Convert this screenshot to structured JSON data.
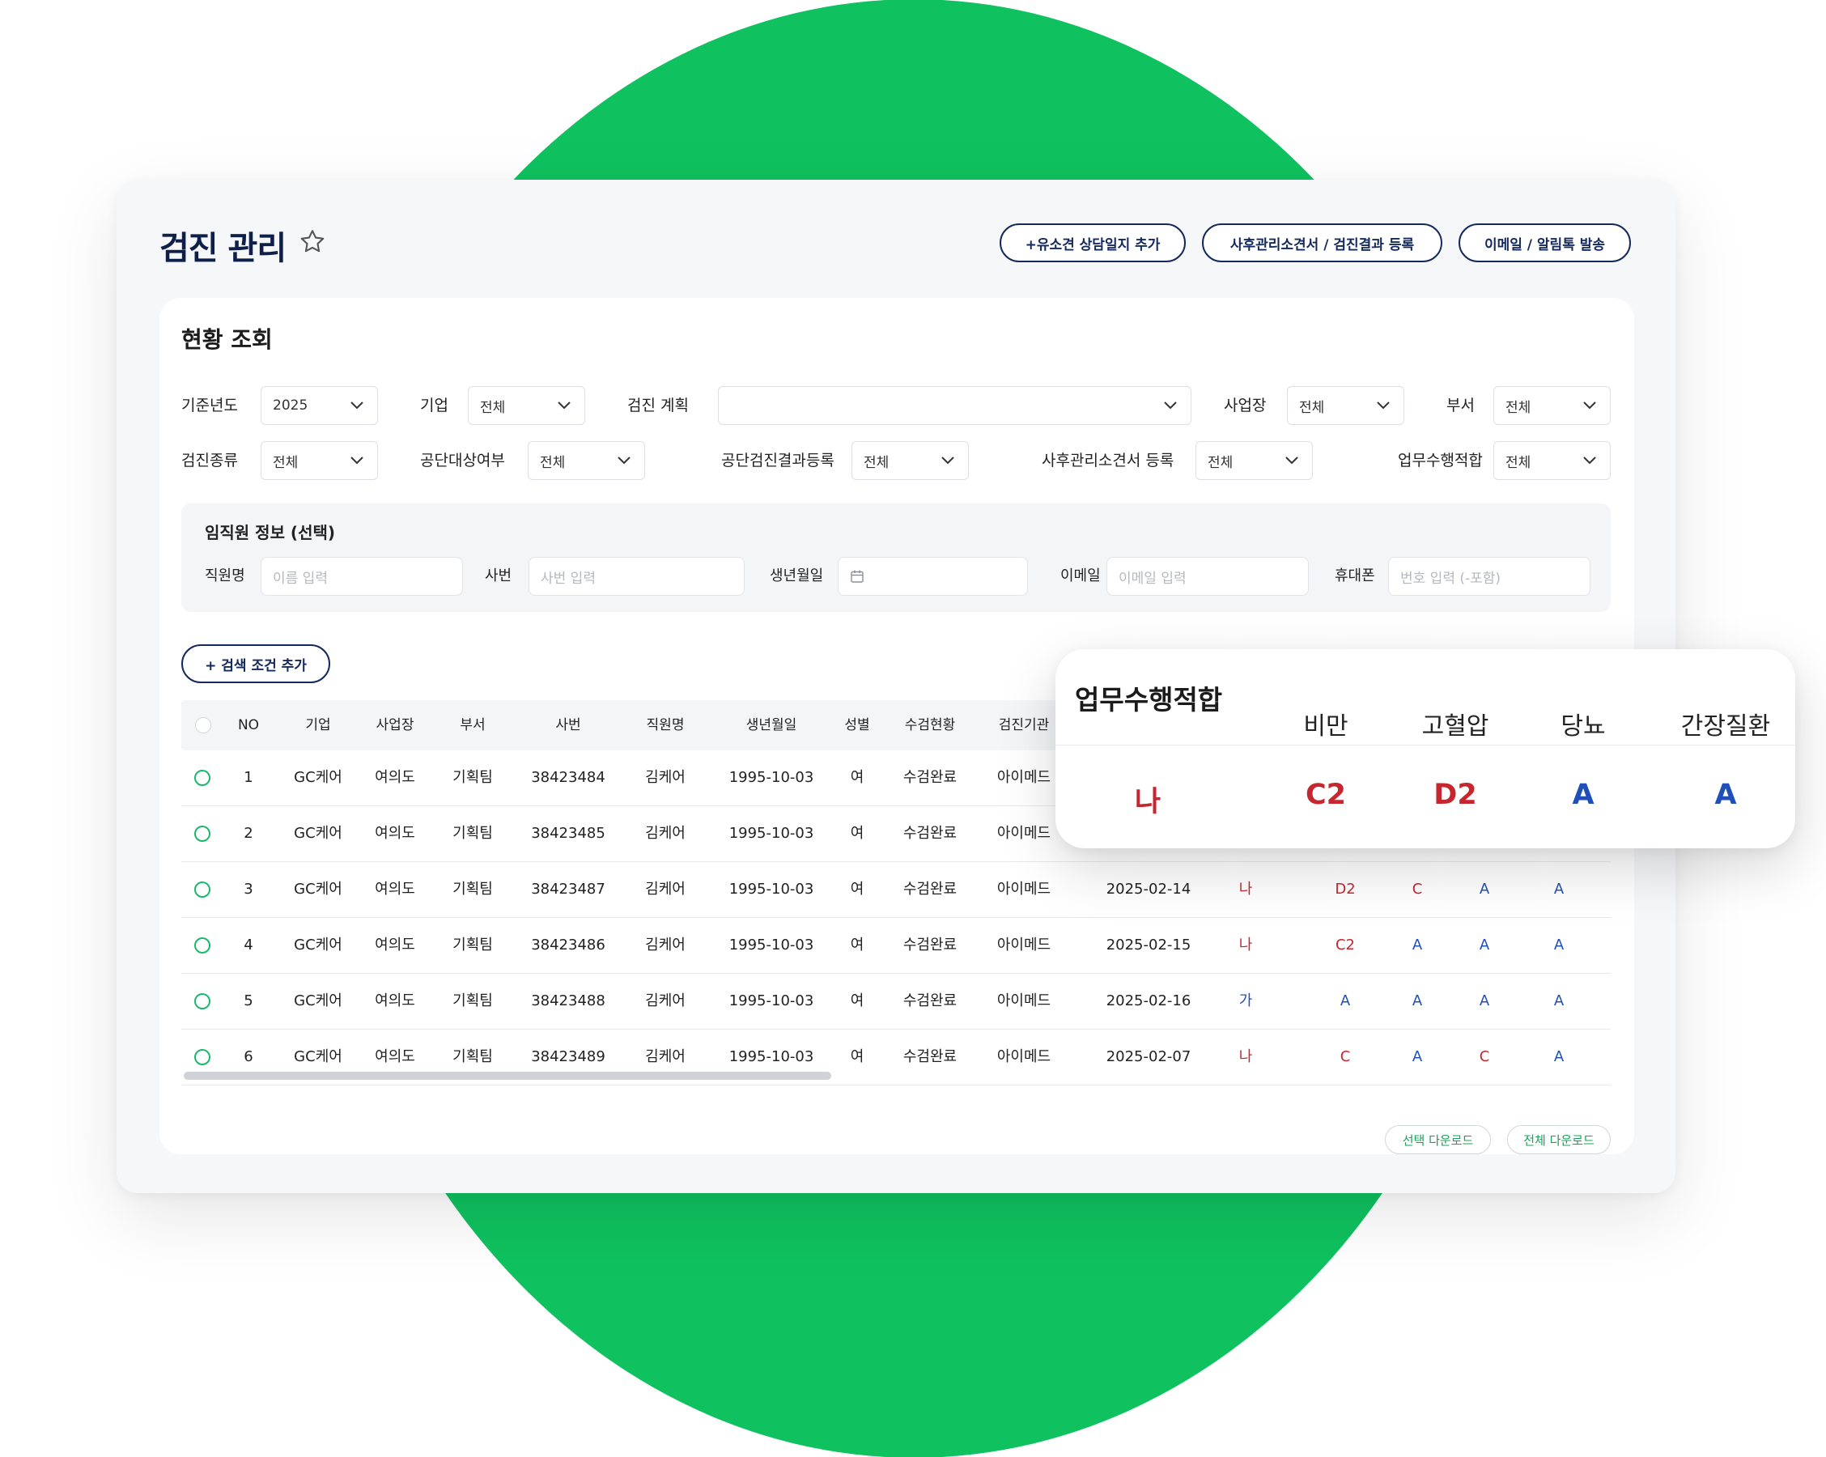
{
  "header": {
    "title": "검진 관리",
    "buttons": {
      "add_log": "+유소견 상담일지 추가",
      "register": "사후관리소견서 / 검진결과 등록",
      "send": "이메일 / 알림톡 발송"
    }
  },
  "status_card": {
    "title": "현황 조회",
    "filters": {
      "year": {
        "label": "기준년도",
        "value": "2025"
      },
      "company": {
        "label": "기업",
        "value": "전체"
      },
      "plan": {
        "label": "검진 계획",
        "value": ""
      },
      "site": {
        "label": "사업장",
        "value": "전체"
      },
      "dept": {
        "label": "부서",
        "value": "전체"
      },
      "checkup_type": {
        "label": "검진종류",
        "value": "전체"
      },
      "nhis_target": {
        "label": "공단대상여부",
        "value": "전체"
      },
      "nhis_result": {
        "label": "공단검진결과등록",
        "value": "전체"
      },
      "followup_reg": {
        "label": "사후관리소견서 등록",
        "value": "전체"
      },
      "fitness": {
        "label": "업무수행적합",
        "value": "전체"
      }
    },
    "employee": {
      "title": "임직원 정보 (선택)",
      "name": {
        "label": "직원명",
        "placeholder": "이름 입력"
      },
      "emp_no": {
        "label": "사번",
        "placeholder": "사번 입력"
      },
      "birth": {
        "label": "생년월일",
        "placeholder": ""
      },
      "email": {
        "label": "이메일",
        "placeholder": "이메일 입력"
      },
      "phone": {
        "label": "휴대폰",
        "placeholder": "번호 입력 (-포함)"
      }
    },
    "add_condition": "+ 검색 조건 추가",
    "download_selected": "선택 다운로드",
    "download_all": "전체 다운로드"
  },
  "table": {
    "headers": [
      "NO",
      "기업",
      "사업장",
      "부서",
      "사번",
      "직원명",
      "생년월일",
      "성별",
      "수검현황",
      "검진기관"
    ],
    "rows": [
      {
        "no": "1",
        "company": "GC케어",
        "site": "여의도",
        "dept": "기획팀",
        "emp_no": "38423484",
        "name": "김케어",
        "birth": "1995-10-03",
        "gender": "여",
        "status": "수검완료",
        "org": "아이메드",
        "date": "",
        "fitness": "",
        "obesity": "",
        "bp": "",
        "diabetes": "",
        "liver": ""
      },
      {
        "no": "2",
        "company": "GC케어",
        "site": "여의도",
        "dept": "기획팀",
        "emp_no": "38423485",
        "name": "김케어",
        "birth": "1995-10-03",
        "gender": "여",
        "status": "수검완료",
        "org": "아이메드",
        "date": "",
        "fitness": "",
        "obesity": "",
        "bp": "",
        "diabetes": "",
        "liver": ""
      },
      {
        "no": "3",
        "company": "GC케어",
        "site": "여의도",
        "dept": "기획팀",
        "emp_no": "38423487",
        "name": "김케어",
        "birth": "1995-10-03",
        "gender": "여",
        "status": "수검완료",
        "org": "아이메드",
        "date": "2025-02-14",
        "fitness": "나",
        "obesity": "D2",
        "bp": "C",
        "diabetes": "A",
        "liver": "A"
      },
      {
        "no": "4",
        "company": "GC케어",
        "site": "여의도",
        "dept": "기획팀",
        "emp_no": "38423486",
        "name": "김케어",
        "birth": "1995-10-03",
        "gender": "여",
        "status": "수검완료",
        "org": "아이메드",
        "date": "2025-02-15",
        "fitness": "나",
        "obesity": "C2",
        "bp": "A",
        "diabetes": "A",
        "liver": "A"
      },
      {
        "no": "5",
        "company": "GC케어",
        "site": "여의도",
        "dept": "기획팀",
        "emp_no": "38423488",
        "name": "김케어",
        "birth": "1995-10-03",
        "gender": "여",
        "status": "수검완료",
        "org": "아이메드",
        "date": "2025-02-16",
        "fitness": "가",
        "obesity": "A",
        "bp": "A",
        "diabetes": "A",
        "liver": "A"
      },
      {
        "no": "6",
        "company": "GC케어",
        "site": "여의도",
        "dept": "기획팀",
        "emp_no": "38423489",
        "name": "김케어",
        "birth": "1995-10-03",
        "gender": "여",
        "status": "수검완료",
        "org": "아이메드",
        "date": "2025-02-07",
        "fitness": "나",
        "obesity": "C",
        "bp": "A",
        "diabetes": "C",
        "liver": "A"
      }
    ]
  },
  "popup": {
    "fitness_label": "업무수행적합",
    "fitness_value": "나",
    "columns": [
      "비만",
      "고혈압",
      "당뇨",
      "간장질환"
    ],
    "values": [
      "C2",
      "D2",
      "A",
      "A"
    ]
  },
  "colors": {
    "brand_green": "#0fc25f",
    "navy": "#142a5c",
    "grade_red": "#c6262e",
    "grade_blue": "#1f4fb8"
  }
}
